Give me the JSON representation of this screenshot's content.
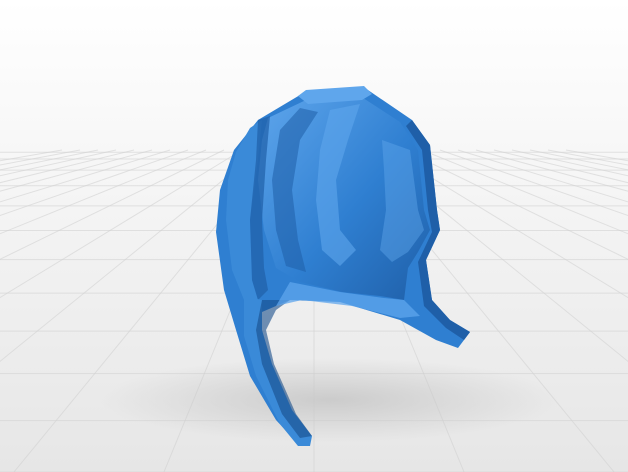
{
  "scene": {
    "subject": "helmet-shell-model",
    "colors": {
      "background_top": "#ffffff",
      "background_bottom": "#e6e6e6",
      "grid_line": "#d2d2d2",
      "model_base": "#2f7fd1",
      "model_light": "#5fa6ec",
      "model_mid": "#3a8ad8",
      "model_dark": "#1f5fa8",
      "model_deep": "#174c8a",
      "shadow": "#c8c8c8"
    }
  }
}
